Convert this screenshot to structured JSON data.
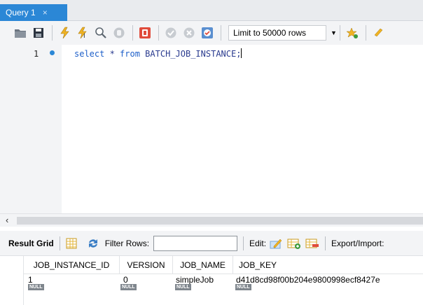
{
  "tab": {
    "title": "Query 1",
    "close": "×"
  },
  "toolbar": {
    "icons": [
      "folder-open-icon",
      "save-icon",
      "execute-icon",
      "execute-current-icon",
      "explain-icon",
      "stop-icon",
      "toggle-continue-icon",
      "commit-icon",
      "rollback-icon",
      "autocommit-icon",
      "beautify-icon",
      "find-icon"
    ],
    "limit_label": "Limit to 50000 rows"
  },
  "editor": {
    "line_number": "1",
    "code_kw1": "select",
    "code_star": " * ",
    "code_kw2": "from",
    "code_table": " BATCH_JOB_INSTANCE;"
  },
  "results": {
    "grid_label": "Result Grid",
    "filter_label": "Filter Rows:",
    "edit_label": "Edit:",
    "export_label": "Export/Import:",
    "columns": [
      "JOB_INSTANCE_ID",
      "VERSION",
      "JOB_NAME",
      "JOB_KEY"
    ],
    "row": [
      "1",
      "0",
      "simpleJob",
      "d41d8cd98f00b204e9800998ecf8427e"
    ],
    "null_label": "NULL"
  },
  "colors": {
    "tab": "#2b87d6",
    "keyword": "#1d5fc9",
    "chrome": "#f3f4f6"
  }
}
